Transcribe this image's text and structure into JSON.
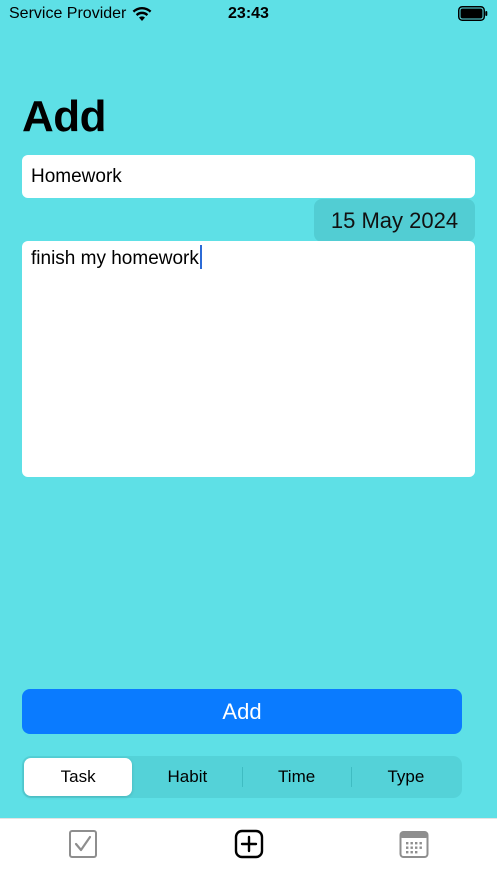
{
  "status_bar": {
    "carrier": "Service Provider",
    "time": "23:43",
    "wifi_icon": "wifi-icon",
    "battery_icon": "battery-icon"
  },
  "page": {
    "title": "Add"
  },
  "form": {
    "task_name_value": "Homework",
    "date": "15 May 2024",
    "description_value": "finish my homework"
  },
  "actions": {
    "add_label": "Add"
  },
  "segmented_control": {
    "options": [
      "Task",
      "Habit",
      "Time",
      "Type"
    ],
    "selected": "Task"
  },
  "tab_bar": {
    "icons": [
      "checkbox-icon",
      "plus-square-icon",
      "calendar-icon"
    ],
    "selected_icon": "plus-square-icon"
  },
  "colors": {
    "background": "#5ee0e6",
    "accent": "#0a7bff"
  }
}
